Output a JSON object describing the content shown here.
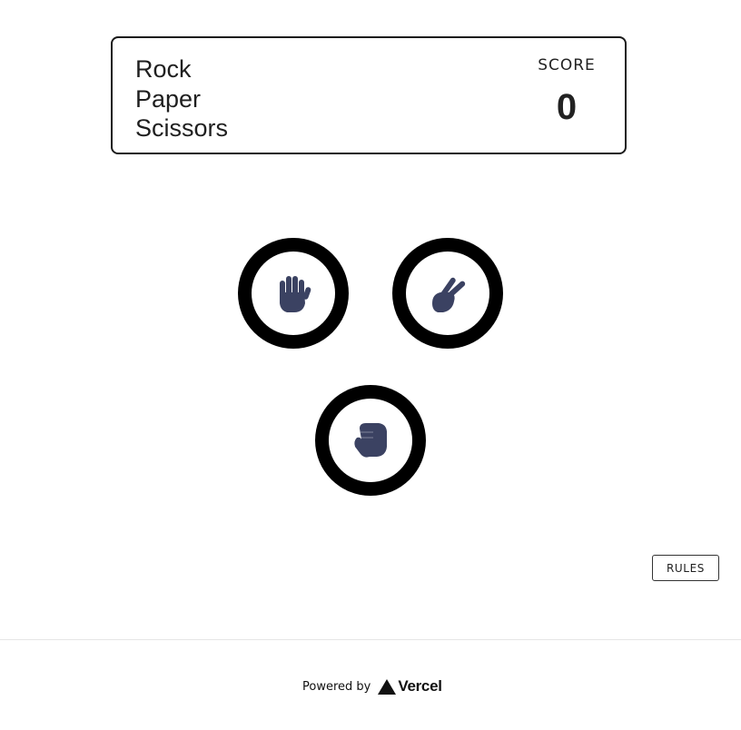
{
  "header": {
    "title_lines": [
      "Rock",
      "Paper",
      "Scissors"
    ],
    "score_label": "SCORE",
    "score_value": "0"
  },
  "choices": [
    {
      "id": "paper",
      "icon": "hand-paper-icon",
      "ring_color": "#000000",
      "icon_color": "#3b4262"
    },
    {
      "id": "scissors",
      "icon": "hand-scissors-icon",
      "ring_color": "#000000",
      "icon_color": "#3b4262"
    },
    {
      "id": "rock",
      "icon": "hand-rock-icon",
      "ring_color": "#000000",
      "icon_color": "#3b4262"
    }
  ],
  "rules_button": {
    "label": "RULES"
  },
  "footer": {
    "powered_by": "Powered by",
    "brand": "Vercel",
    "brand_icon": "vercel-triangle-icon"
  }
}
